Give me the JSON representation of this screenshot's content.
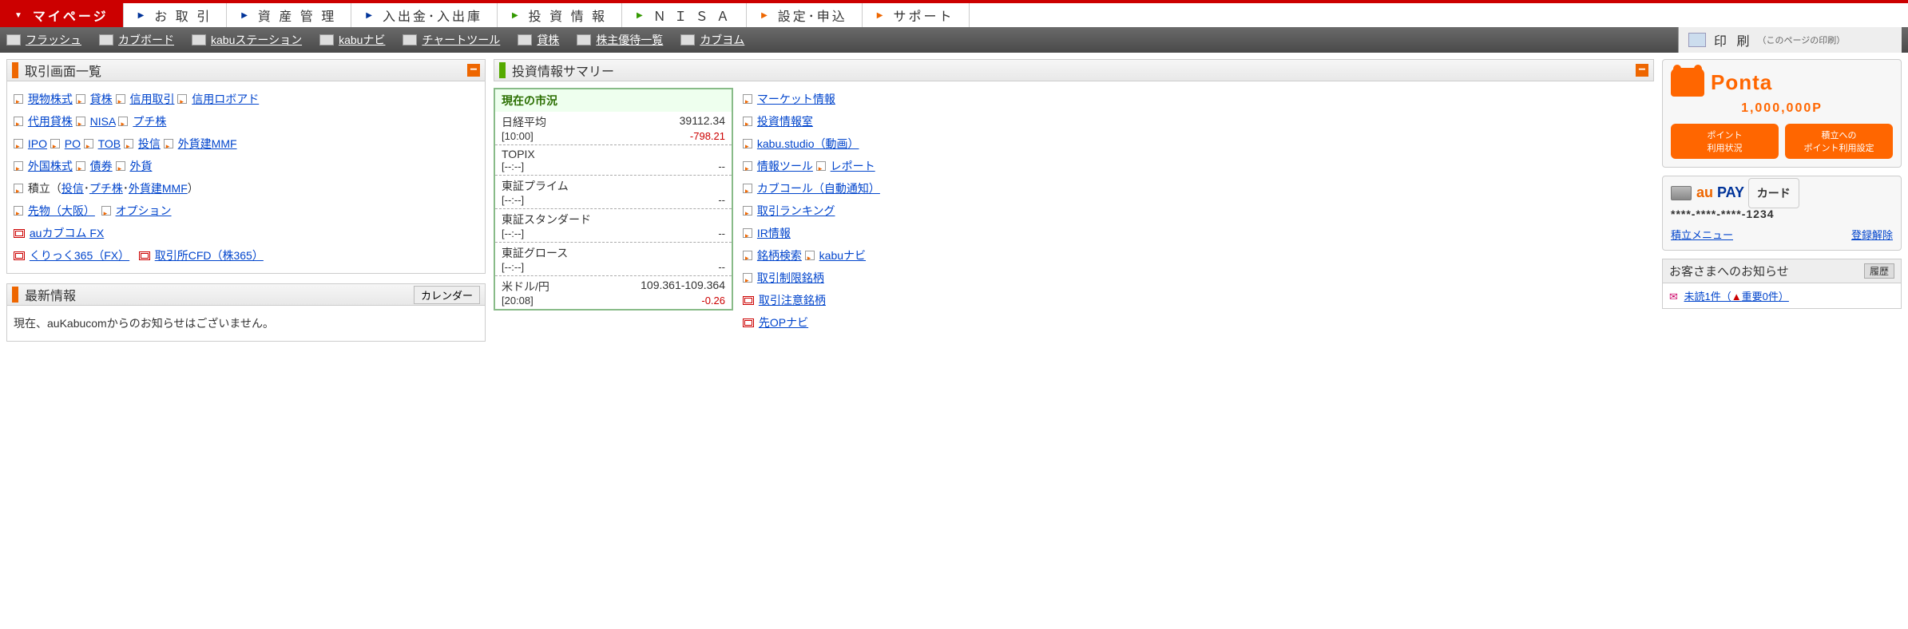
{
  "topnav": {
    "tabs": [
      {
        "label": "マイページ",
        "arrow": "▼",
        "active": true,
        "cls": ""
      },
      {
        "label": "お 取 引",
        "arrow": "▶",
        "cls": "ar-b"
      },
      {
        "label": "資 産 管 理",
        "arrow": "▶",
        "cls": "ar-b"
      },
      {
        "label": "入出金･入出庫",
        "arrow": "▶",
        "cls": "ar-b"
      },
      {
        "label": "投 資 情 報",
        "arrow": "▶",
        "cls": "ar-g"
      },
      {
        "label": "Ｎ Ｉ Ｓ Ａ",
        "arrow": "▶",
        "cls": "ar-g"
      },
      {
        "label": "設定･申込",
        "arrow": "▶",
        "cls": "ar-o"
      },
      {
        "label": "サポート",
        "arrow": "▶",
        "cls": "ar-o"
      }
    ]
  },
  "toolbar": {
    "items": [
      "フラッシュ",
      "カブボード",
      "kabuステーション",
      "kabuナビ",
      "チャートツール",
      "貸株",
      "株主優待一覧",
      "カブヨム"
    ],
    "print_label": "印 刷",
    "print_sub": "（このページの印刷）"
  },
  "trade_list": {
    "title": "取引画面一覧",
    "rows": [
      [
        {
          "t": "現物株式"
        },
        {
          "t": "貸株"
        },
        {
          "t": "信用取引"
        },
        {
          "t": "信用ロボアド"
        }
      ],
      [
        {
          "t": "代用貸株"
        },
        {
          "t": "NISA"
        },
        {
          "t": "プチ株"
        }
      ],
      [
        {
          "t": "IPO"
        },
        {
          "t": "PO"
        },
        {
          "t": "TOB"
        },
        {
          "t": "投信"
        },
        {
          "t": "外貨建MMF"
        }
      ],
      [
        {
          "t": "外国株式"
        },
        {
          "t": "債券"
        },
        {
          "t": "外貨"
        }
      ]
    ],
    "tsumitate_prefix": "積立（",
    "tsumitate_items": [
      "投信",
      "プチ株",
      "外貨建MMF"
    ],
    "tsumitate_suffix": "）",
    "sakimono": "先物（大阪）",
    "option": "オプション",
    "aukabu": "auカブコム FX",
    "kuri": "くりっく365（FX）",
    "cfd": "取引所CFD（株365）"
  },
  "news": {
    "title": "最新情報",
    "calendar_btn": "カレンダー",
    "body": "現在、auKabucomからのお知らせはございません。"
  },
  "invest_summary": {
    "title": "投資情報サマリー"
  },
  "market": {
    "title": "現在の市況",
    "rows": [
      {
        "name": "日経平均",
        "val": "39112.34",
        "time": "[10:00]",
        "chg": "-798.21",
        "neg": true
      },
      {
        "name": "TOPIX",
        "val": "",
        "time": "[--:--]",
        "chg": "--"
      },
      {
        "name": "東証プライム",
        "val": "",
        "time": "[--:--]",
        "chg": "--"
      },
      {
        "name": "東証スタンダード",
        "val": "",
        "time": "[--:--]",
        "chg": "--"
      },
      {
        "name": "東証グロース",
        "val": "",
        "time": "[--:--]",
        "chg": "--"
      },
      {
        "name": "米ドル/円",
        "val": "109.361-109.364",
        "time": "[20:08]",
        "chg": "-0.26",
        "neg": true
      }
    ]
  },
  "info_links": {
    "items": [
      [
        "マーケット情報"
      ],
      [
        "投資情報室"
      ],
      [
        "kabu.studio（動画）"
      ],
      [
        "情報ツール",
        "レポート"
      ],
      [
        "カブコール（自動通知）"
      ],
      [
        "取引ランキング"
      ],
      [
        "IR情報"
      ],
      [
        "銘柄検索",
        "kabuナビ"
      ],
      [
        "取引制限銘柄"
      ],
      [
        "取引注意銘柄"
      ],
      [
        "先OPナビ"
      ]
    ],
    "red_indices": [
      9,
      10
    ]
  },
  "ponta": {
    "brand": "Ponta",
    "points": "1,000,000P",
    "btn1_l1": "ポイント",
    "btn1_l2": "利用状況",
    "btn2_l1": "積立への",
    "btn2_l2": "ポイント利用設定"
  },
  "aupay": {
    "brand_au": "au",
    "brand_pay": " PAY ",
    "brand_card": "カード",
    "number": "****-****-****-1234",
    "link1": "積立メニュー",
    "link2": "登録解除"
  },
  "notice": {
    "title": "お客さまへのお知らせ",
    "history_btn": "履歴",
    "unread": "未読1件（",
    "warn": "重要0件",
    "unread_end": "）"
  }
}
